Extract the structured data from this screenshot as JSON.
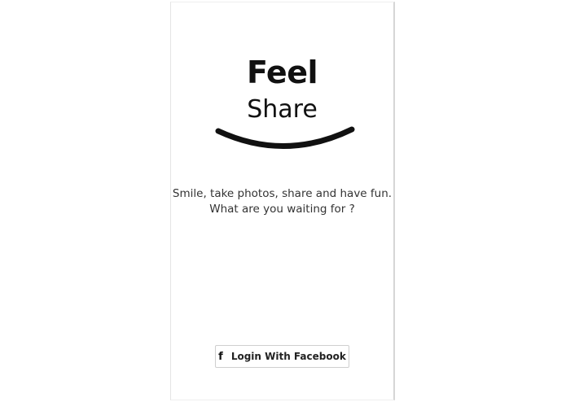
{
  "app": {
    "title_primary": "Feel",
    "title_secondary": "Share"
  },
  "tagline": {
    "line1": "Smile, take photos, share and have fun.",
    "line2": "What are you waiting for ?"
  },
  "login_button": {
    "icon": "facebook-icon",
    "label": "Login With Facebook"
  },
  "colors": {
    "text": "#111111",
    "background": "#ffffff",
    "button_border": "#cfcfcf"
  }
}
